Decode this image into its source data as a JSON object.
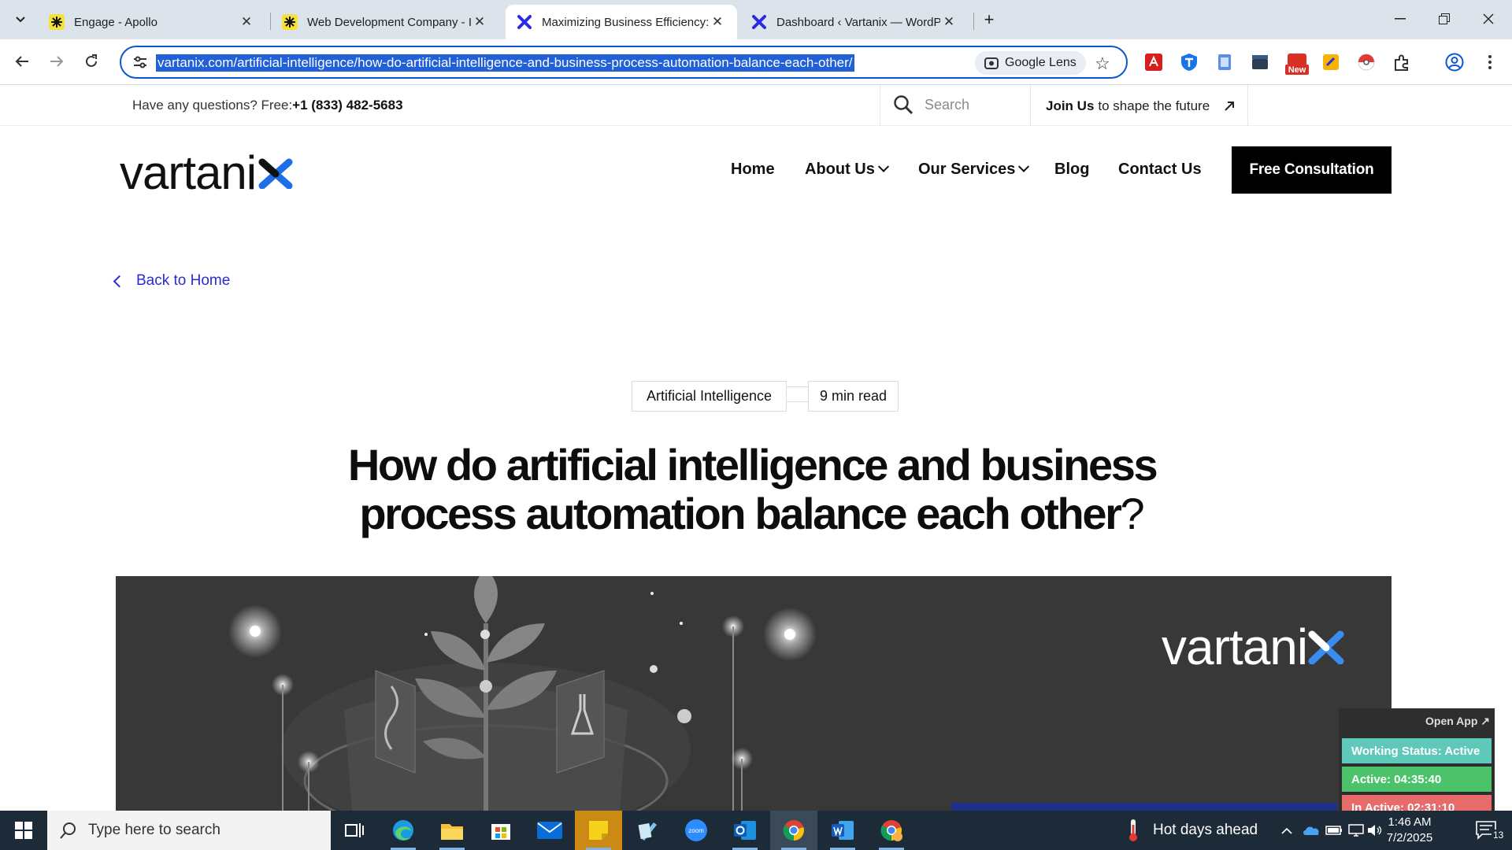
{
  "browser": {
    "tabs": [
      {
        "title": "Engage - Apollo",
        "active": false
      },
      {
        "title": "Web Development Company - I",
        "active": false
      },
      {
        "title": "Maximizing Business Efficiency:",
        "active": true
      },
      {
        "title": "Dashboard ‹ Vartanix — WordP",
        "active": false
      }
    ],
    "url": "vartanix.com/artificial-intelligence/how-do-artificial-intelligence-and-business-process-automation-balance-each-other/",
    "lens_label": "Google Lens",
    "new_badge": "New"
  },
  "site": {
    "topbar": {
      "question": "Have any questions? Free:",
      "phone": "+1 (833) 482-5683",
      "search_placeholder": "Search",
      "join_bold": "Join Us",
      "join_rest": "to shape the future"
    },
    "logo": "vartani",
    "nav": {
      "home": "Home",
      "about": "About Us",
      "services": "Our Services",
      "blog": "Blog",
      "contact": "Contact Us",
      "cta": "Free Consultation"
    },
    "back_link": "Back to Home",
    "category": "Artificial Intelligence",
    "read_time": "9 min read",
    "title_main": "How do artificial intelligence and business process automation balance each other",
    "title_q": "?",
    "hero_logo": "vartani"
  },
  "tracker": {
    "open_app": "Open App ↗",
    "status": "Working Status: Active",
    "active": "Active: 04:35:40",
    "inactive": "In Active: 02:31:10",
    "colors": {
      "status": "#5fc9b9",
      "active": "#4cc26a",
      "inactive": "#e86b6b"
    }
  },
  "taskbar": {
    "search_placeholder": "Type here to search",
    "weather": "Hot days ahead",
    "time": "1:46 AM",
    "date": "7/2/2025",
    "notifications": "13"
  }
}
